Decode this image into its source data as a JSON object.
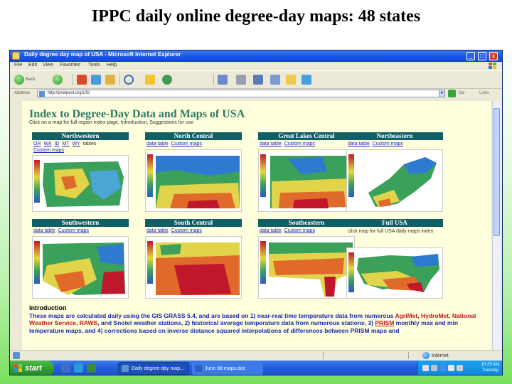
{
  "slide": {
    "title": "IPPC daily online degree-day maps: 48 states"
  },
  "window": {
    "title": "Daily degree day map of USA - Microsoft Internet Explorer",
    "buttons": {
      "minimize": "_",
      "maximize": "□",
      "close": "x"
    }
  },
  "menu": [
    "File",
    "Edit",
    "View",
    "Favorites",
    "Tools",
    "Help"
  ],
  "toolbar": {
    "back_label": "Back",
    "forward_label": ""
  },
  "address": {
    "label": "Address",
    "url": "http://pnwpest.org/US/",
    "go_label": "Go",
    "links_label": "Links"
  },
  "page": {
    "heading": "Index to Degree-Day Data and Maps of USA",
    "subheading": "Click on a map for full region index page. Introduction, Suggestions for use",
    "regions": [
      {
        "name": "Northwestern",
        "links": [
          "OR",
          "WA",
          "ID",
          "MT",
          "WY"
        ],
        "links_suffix": "tables",
        "link2": "Custom maps"
      },
      {
        "name": "North Central",
        "links": [
          "data table"
        ],
        "links_suffix": "",
        "link2": "Custom maps"
      },
      {
        "name": "Great Lakes Central",
        "links": [
          "data table"
        ],
        "links_suffix": "",
        "link2": "Custom maps"
      },
      {
        "name": "Northeastern",
        "links": [
          "data table"
        ],
        "links_suffix": "",
        "link2": "Custom maps"
      },
      {
        "name": "Southwestern",
        "links": [
          "data table"
        ],
        "links_suffix": "",
        "link2": "Custom maps"
      },
      {
        "name": "South Central",
        "links": [
          "data table"
        ],
        "links_suffix": "",
        "link2": "Custom maps"
      },
      {
        "name": "Southeastern",
        "links": [
          "data table"
        ],
        "links_suffix": "",
        "link2": "Custom maps"
      },
      {
        "name": "Full USA",
        "note": "click map for full USA daily maps index"
      }
    ],
    "intro": {
      "heading": "Introduction",
      "p1": "These maps are calculated daily using the GIS GRASS 5.4, and are based on 1) near-real time temperature data from numerous ",
      "sources": "AgriMet, HydroMet, National Weather Service, RAWS",
      "p2": ", and Snotel weather stations, 2) historical average temperature data from numerous stations, 3) ",
      "prism": "PRISM",
      "p3": " monthly max and min temperature maps, and 4) corrections based on inverse distance squared interpolations of differences between PRISM maps and"
    }
  },
  "status": {
    "zone": "Internet"
  },
  "taskbar": {
    "start_label": "start",
    "tasks": [
      "Daily degree day map...",
      "June dd maps.doc"
    ],
    "clock_time": "10:25 AM",
    "clock_day": "Tuesday"
  },
  "colors": {
    "region_header": "#0f5f64",
    "heading": "#2a7a64",
    "link": "#1b28c6",
    "content_bg": "#fffedd"
  }
}
